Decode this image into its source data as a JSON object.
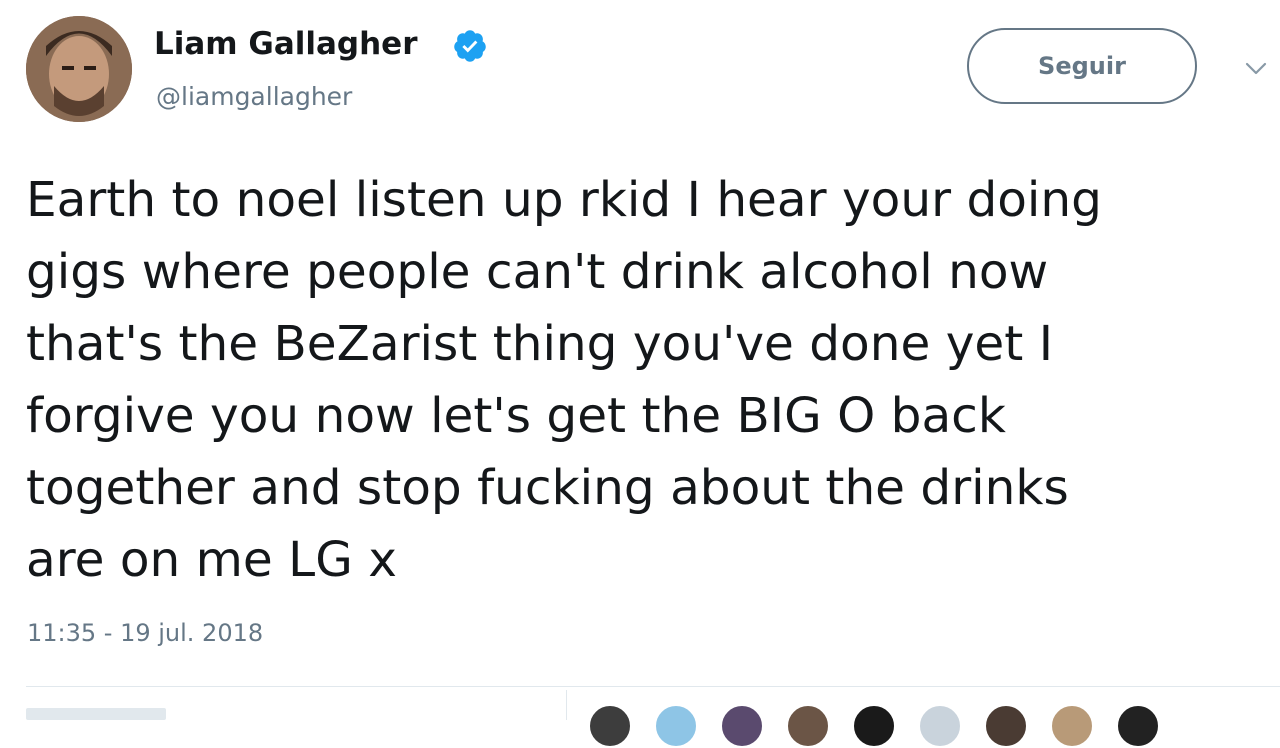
{
  "author": {
    "name": "Liam Gallagher",
    "handle": "@liamgallagher",
    "verified": true,
    "verified_icon": "verified-badge-icon"
  },
  "actions": {
    "follow_label": "Seguir",
    "more_icon": "chevron-down-icon"
  },
  "tweet": {
    "text": "Earth to noel listen up rkid I hear your doing\ngigs where people can't drink alcohol now\nthat's the BeZarist thing you've done yet I\nforgive you now let's get the BIG O back\ntogether and stop fucking about the drinks\nare on me LG x",
    "timestamp": "11:35 - 19 jul. 2018"
  },
  "colors": {
    "text": "#14171a",
    "secondary": "#657786",
    "verified": "#1da1f2",
    "divider": "#e1e8ed"
  },
  "likers": [
    {
      "color": "#3d3d3d"
    },
    {
      "color": "#8ec5e6"
    },
    {
      "color": "#5a4a6e"
    },
    {
      "color": "#6b5546"
    },
    {
      "color": "#1a1a1a"
    },
    {
      "color": "#c9d3dc"
    },
    {
      "color": "#4a3b33"
    },
    {
      "color": "#b89a78"
    },
    {
      "color": "#222222"
    }
  ]
}
